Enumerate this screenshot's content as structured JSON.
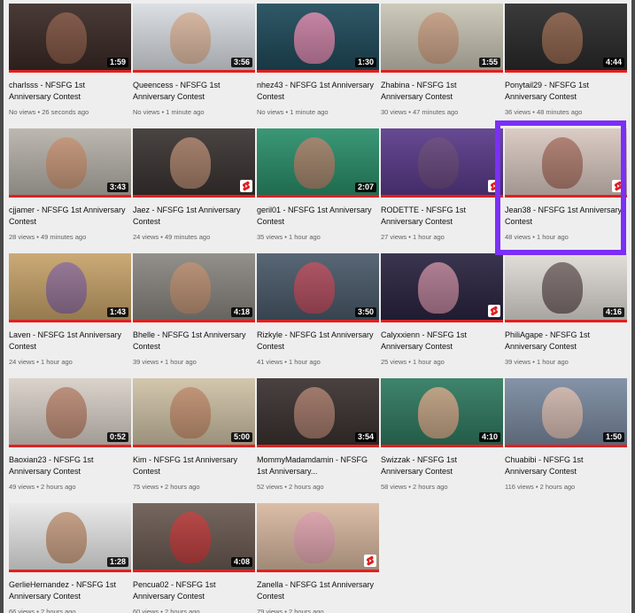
{
  "accent_color": "#e02020",
  "highlight_color": "#7b2ff7",
  "videos": [
    {
      "title": "charlsss - NFSFG 1st Anniversary Contest",
      "views": "No views",
      "age": "26 seconds ago",
      "duration": "1:59",
      "bg": "#3a2a26",
      "skin": "#8a5a48",
      "shorts": false
    },
    {
      "title": "Queencess - NFSFG 1st Anniversary Contest",
      "views": "No views",
      "age": "1 minute ago",
      "duration": "3:56",
      "bg": "#d9dde2",
      "skin": "#d8b094",
      "shorts": false
    },
    {
      "title": "nhez43 - NFSFG 1st Anniversary Contest",
      "views": "No views",
      "age": "1 minute ago",
      "duration": "1:30",
      "bg": "#1f4a5a",
      "skin": "#e68ab0",
      "shorts": false
    },
    {
      "title": "Zhabina - NFSFG 1st Anniversary Contest",
      "views": "30 views",
      "age": "47 minutes ago",
      "duration": "1:55",
      "bg": "#c9c5b5",
      "skin": "#c89a7e",
      "shorts": false
    },
    {
      "title": "Ponytail29 - NFSFG 1st Anniversary Contest",
      "views": "36 views",
      "age": "48 minutes ago",
      "duration": "4:44",
      "bg": "#2a2a2a",
      "skin": "#9a6a50",
      "shorts": false
    },
    {
      "title": "cjjamer - NFSFG 1st Anniversary Contest",
      "views": "28 views",
      "age": "49 minutes ago",
      "duration": "3:43",
      "bg": "#b7b2aa",
      "skin": "#c89070",
      "shorts": false
    },
    {
      "title": "Jaez - NFSFG 1st Anniversary Contest",
      "views": "24 views",
      "age": "49 minutes ago",
      "duration": "",
      "bg": "#3a3432",
      "skin": "#b58870",
      "shorts": true
    },
    {
      "title": "geril01 - NFSFG 1st Anniversary Contest",
      "views": "35 views",
      "age": "1 hour ago",
      "duration": "2:07",
      "bg": "#2a8f6a",
      "skin": "#b48068",
      "shorts": false
    },
    {
      "title": "RODETTE - NFSFG 1st Anniversary Contest",
      "views": "27 views",
      "age": "1 hour ago",
      "duration": "",
      "bg": "#5a3a8a",
      "skin": "#6a4a7a",
      "shorts": true
    },
    {
      "title": "Jean38 - NFSFG 1st Anniversary Contest",
      "views": "48 views",
      "age": "1 hour ago",
      "duration": "",
      "bg": "#d8c8c0",
      "skin": "#a87060",
      "shorts": true
    },
    {
      "title": "Laven - NFSFG 1st Anniversary Contest",
      "views": "24 views",
      "age": "1 hour ago",
      "duration": "1:43",
      "bg": "#c7a36a",
      "skin": "#8a6a9a",
      "shorts": false
    },
    {
      "title": "Bhelle - NFSFG 1st Anniversary Contest",
      "views": "39 views",
      "age": "1 hour ago",
      "duration": "4:18",
      "bg": "#8a8680",
      "skin": "#c09070",
      "shorts": false
    },
    {
      "title": "Rizkyle - NFSFG 1st Anniversary Contest",
      "views": "41 views",
      "age": "1 hour ago",
      "duration": "3:50",
      "bg": "#4a5a6a",
      "skin": "#c04a5a",
      "shorts": false
    },
    {
      "title": "Calyxxienn - NFSFG 1st Anniversary Contest",
      "views": "25 views",
      "age": "1 hour ago",
      "duration": "",
      "bg": "#2a2440",
      "skin": "#c88aa0",
      "shorts": true
    },
    {
      "title": "PhiliAgape - NFSFG 1st Anniversary Contest",
      "views": "39 views",
      "age": "1 hour ago",
      "duration": "4:16",
      "bg": "#e0dcd6",
      "skin": "#6a5a5a",
      "shorts": false
    },
    {
      "title": "Baoxian23 - NFSFG 1st Anniversary Contest",
      "views": "49 views",
      "age": "2 hours ago",
      "duration": "0:52",
      "bg": "#d8d0c8",
      "skin": "#b88068",
      "shorts": false
    },
    {
      "title": "Kim - NFSFG 1st Anniversary Contest",
      "views": "75 views",
      "age": "2 hours ago",
      "duration": "5:00",
      "bg": "#cfc2a6",
      "skin": "#c08a68",
      "shorts": false
    },
    {
      "title": "MommyMadamdamin - NFSFG 1st Anniversary...",
      "views": "52 views",
      "age": "2 hours ago",
      "duration": "3:54",
      "bg": "#3a3230",
      "skin": "#b08070",
      "shorts": false
    },
    {
      "title": "Swizzak - NFSFG 1st Anniversary Contest",
      "views": "58 views",
      "age": "2 hours ago",
      "duration": "4:10",
      "bg": "#2f7a60",
      "skin": "#d8a888",
      "shorts": false
    },
    {
      "title": "Chuabibi - NFSFG 1st Anniversary Contest",
      "views": "116 views",
      "age": "2 hours ago",
      "duration": "1:50",
      "bg": "#7a8aa0",
      "skin": "#e0c0b0",
      "shorts": false
    },
    {
      "title": "GerlieHernandez - NFSFG 1st Anniversary Contest",
      "views": "66 views",
      "age": "2 hours ago",
      "duration": "1:28",
      "bg": "#e8e8e8",
      "skin": "#c09070",
      "shorts": false
    },
    {
      "title": "Pencua02 - NFSFG 1st Anniversary Contest",
      "views": "60 views",
      "age": "2 hours ago",
      "duration": "4:08",
      "bg": "#6a5a52",
      "skin": "#c43a3a",
      "shorts": false
    },
    {
      "title": "Zanella - NFSFG 1st Anniversary Contest",
      "views": "79 views",
      "age": "2 hours ago",
      "duration": "",
      "bg": "#d8b8a0",
      "skin": "#e0a0b0",
      "shorts": true
    }
  ]
}
